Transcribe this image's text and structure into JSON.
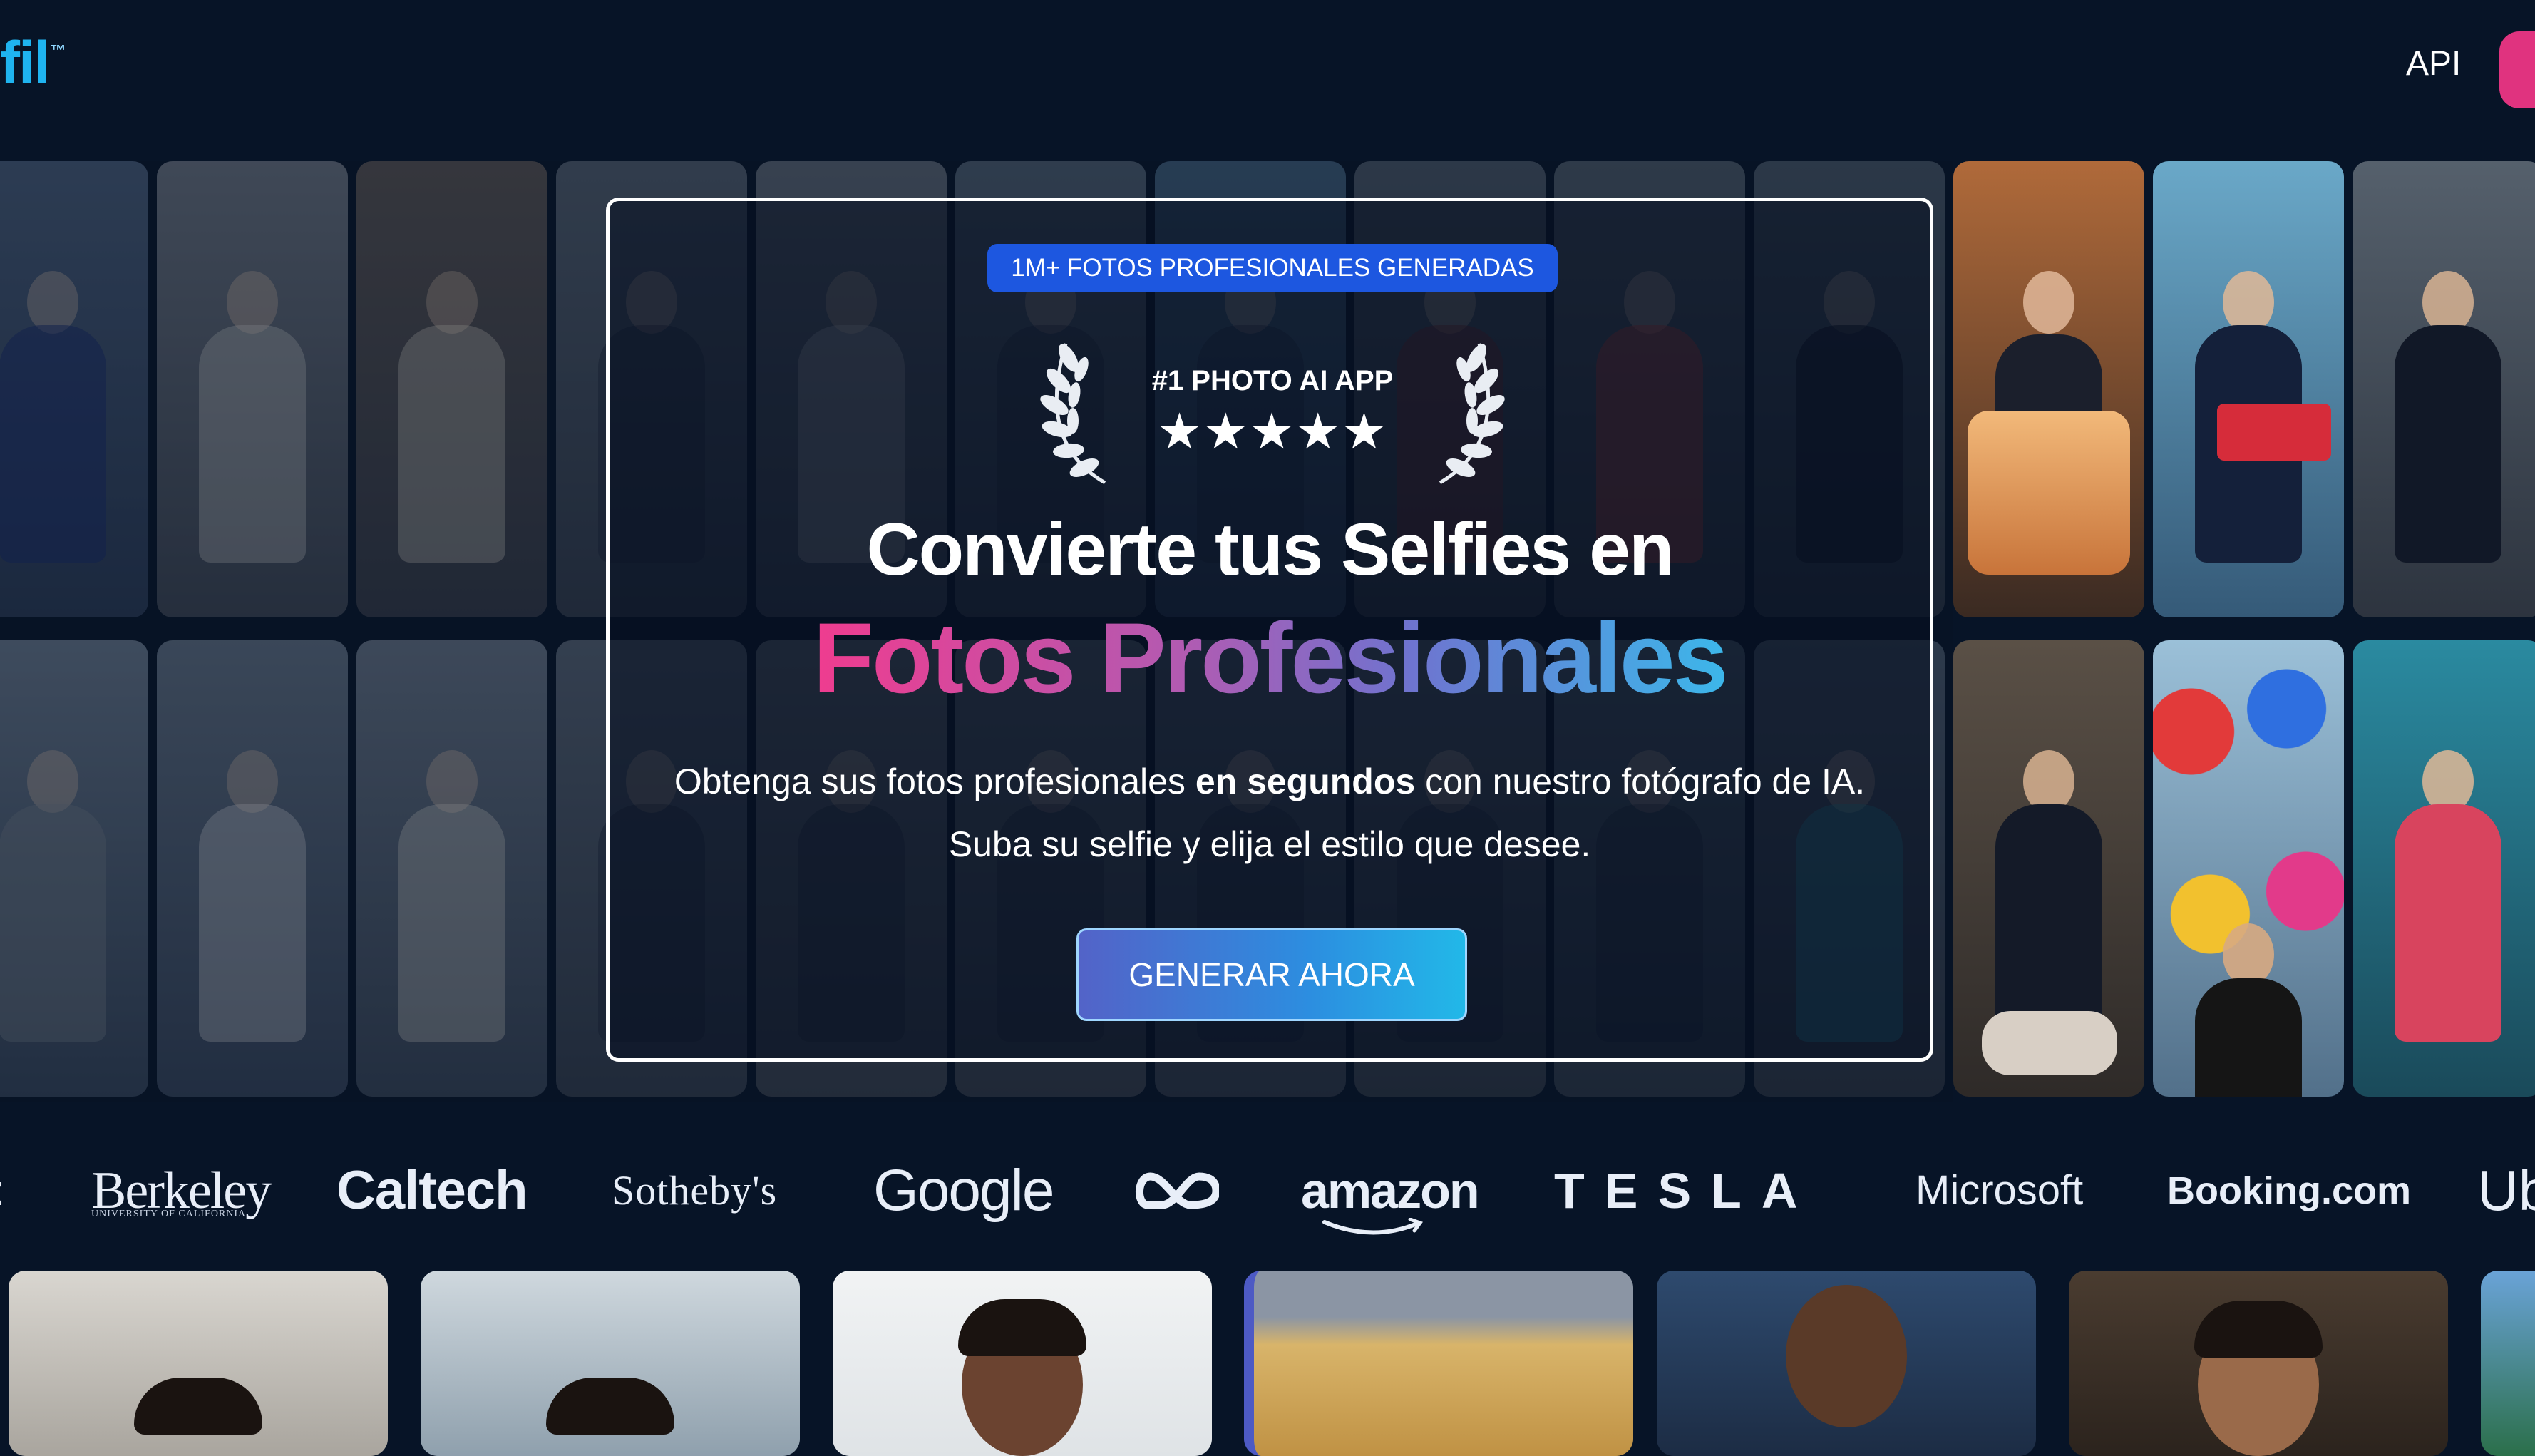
{
  "nav": {
    "logo_text": "fil",
    "logo_mark": "™",
    "api_label": "API"
  },
  "hero": {
    "badge": "1M+ FOTOS PROFESIONALES GENERADAS",
    "award_title": "#1 PHOTO AI APP",
    "stars": "★★★★★",
    "rating_stars": 5,
    "headline_line1": "Convierte tus Selfies en",
    "headline_line2": "Fotos Profesionales",
    "description_part1": "Obtenga sus fotos profesionales ",
    "description_bold": "en segundos",
    "description_part2": " con nuestro fotógrafo de IA. Suba su selfie y elija el estilo que desee.",
    "cta_label": "GENERAR AHORA"
  },
  "brands": {
    "left_partial": ":",
    "berkeley": "Berkeley",
    "berkeley_sub": "UNIVERSITY OF CALIFORNIA",
    "caltech": "Caltech",
    "sothebys": "Sotheby's",
    "google": "Google",
    "amazon": "amazon",
    "tesla": "TESLA",
    "microsoft": "Microsoft",
    "booking": "Booking.com",
    "uber_partial": "Ub"
  },
  "colors": {
    "background": "#071427",
    "badge_blue": "#1d57e0",
    "gradient_pink": "#ef3c8f",
    "gradient_purple": "#6f73cf",
    "gradient_cyan": "#3cb7ea",
    "nav_cta_pink": "#e0337f"
  },
  "icons": {
    "laurel_left": "laurel-left-icon",
    "laurel_right": "laurel-right-icon",
    "meta_logo": "meta-infinity-icon"
  }
}
